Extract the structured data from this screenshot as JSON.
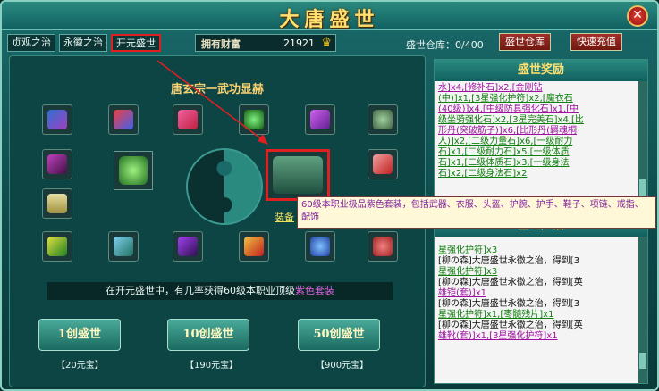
{
  "window": {
    "title": "大唐盛世",
    "close_label": "✕"
  },
  "tabs": [
    {
      "label": "贞观之治"
    },
    {
      "label": "永徽之治"
    },
    {
      "label": "开元盛世"
    }
  ],
  "wealth": {
    "label": "拥有财富",
    "value": "21921"
  },
  "warehouse": {
    "count_label": "盛世仓库：0/400",
    "button": "盛世仓库",
    "recharge": "快速充值"
  },
  "left": {
    "title": "唐玄宗一武功显赫",
    "equip_label": "装备",
    "info_text": "在开元盛世中，有几率获得60级本职业顶级",
    "info_highlight": "紫色套装",
    "draws": [
      {
        "label": "1创盛世",
        "price": "【20元宝】"
      },
      {
        "label": "10创盛世",
        "price": "【190元宝】"
      },
      {
        "label": "50创盛世",
        "price": "【900元宝】"
      }
    ]
  },
  "tooltip": {
    "text": "60级本职业极品紫色套装，包括武器、衣服、头盔、护腕、护手、鞋子、项链、戒指、配饰"
  },
  "rewards": {
    "title": "盛世奖励",
    "lines": [
      "水]x4,[修补石]x2,[金刚钻",
      "(中)]x1,[3星强化护符]x2,[魔衣石",
      "(40级)]x4,[中级防具强化石]x1,[中",
      "级坐骑强化石]x2,[3星完美石]x4,[比",
      "形丹(突破筋子)]x6,[比形丹(羁魂桐",
      "人)]x2,[二级力量石]x6,[一级耐力",
      "石]x1,[二级耐力石]x5,[一级体质",
      "石]x1,[二级体质石]x3,[一级身法",
      "石]x2,[二级身法石]x2"
    ]
  },
  "broadcast": {
    "title": "盛世广播",
    "lines": [
      "星强化护符]x3",
      "[柳の森]大唐盛世永徽之治，得到[3",
      "星强化护符]x3",
      "[柳の森]大唐盛世永徽之治，得到[英",
      "雄铠(套)]x1",
      "[柳の森]大唐盛世永徽之治，得到[3",
      "星强化护符]x1,[枣髓残片]x1",
      "[柳の森]大唐盛世永徽之治，得到[英",
      "雄靴(套)]x1,[3星强化护符]x1"
    ]
  },
  "colors": {
    "accent": "#ffe070",
    "highlight": "#e02020"
  }
}
